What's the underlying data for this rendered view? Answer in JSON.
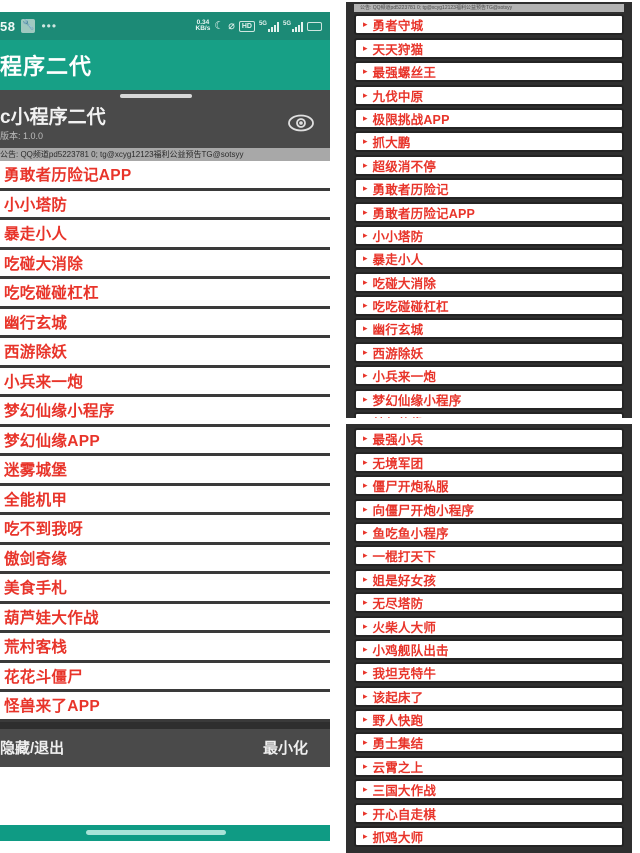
{
  "statusbar": {
    "time": "58",
    "wrench_icon": "wrench-icon",
    "overflow_dots": "•••",
    "net_speed_value": "0.34",
    "net_speed_unit": "KB/s",
    "moon_icon": "☾",
    "mute_icon": "⌀",
    "hd_label": "HD",
    "signal_1_label": "5G",
    "signal_2_label": "5G",
    "battery_label": "⏻"
  },
  "app_header": {
    "title": "程序二代"
  },
  "panel": {
    "title": "c小程序二代",
    "version": "版本: 1.0.0",
    "eye_icon": "eye-icon",
    "grip_icon": "drag-grip-icon",
    "notice": "公告: QQ频道pd5223781 0;  tg@xcyg12123福利公益预告TG@sotsyy"
  },
  "left_list": {
    "items": [
      "勇敢者历险记APP",
      "小小塔防",
      "暴走小人",
      "吃碰大消除",
      "吃吃碰碰杠杠",
      "幽行玄城",
      "西游除妖",
      "小兵来一炮",
      "梦幻仙缘小程序",
      "梦幻仙缘APP",
      "迷雾城堡",
      "全能机甲",
      "吃不到我呀",
      "傲剑奇缘",
      "美食手札",
      "葫芦娃大作战",
      "荒村客栈",
      "花花斗僵尸",
      "怪兽来了APP"
    ]
  },
  "footbar": {
    "hide_exit_label": "隐藏/退出",
    "minimize_label": "最小化"
  },
  "navbar": {
    "home_indicator": "home-indicator"
  },
  "right_panel_top": {
    "notice": "公告: QQ频道pd5223781 0;  tg@xcyg12123福利公益预告TG@sotsyy",
    "bullet": "▸",
    "items": [
      "勇者守城",
      "天天狩猫",
      "最强螺丝王",
      "九伐中原",
      "极限挑战APP",
      "抓大鹏",
      "超级消不停",
      "勇敢者历险记",
      "勇敢者历险记APP",
      "小小塔防",
      "暴走小人",
      "吃碰大消除",
      "吃吃碰碰杠杠",
      "幽行玄城",
      "西游除妖",
      "小兵来一炮",
      "梦幻仙缘小程序",
      "梦幻仙缘APP"
    ]
  },
  "right_panel_bottom": {
    "bullet": "▸",
    "items": [
      "最强小兵",
      "无境军团",
      "僵尸开炮私服",
      "向僵尸开炮小程序",
      "鱼吃鱼小程序",
      "一棍打天下",
      "姐是好女孩",
      "无尽塔防",
      "火柴人大师",
      "小鸡舰队出击",
      "我坦克特牛",
      "该起床了",
      "野人快跑",
      "勇士集结",
      "云霄之上",
      "三国大作战",
      "开心自走棋",
      "抓鸡大师"
    ]
  },
  "colors": {
    "teal_header": "#17a086",
    "teal_status": "#1c8a76",
    "panel_dark": "#4a4a4a",
    "list_text_red": "#e8342a",
    "right_panel_bg": "#2f2f2f"
  }
}
